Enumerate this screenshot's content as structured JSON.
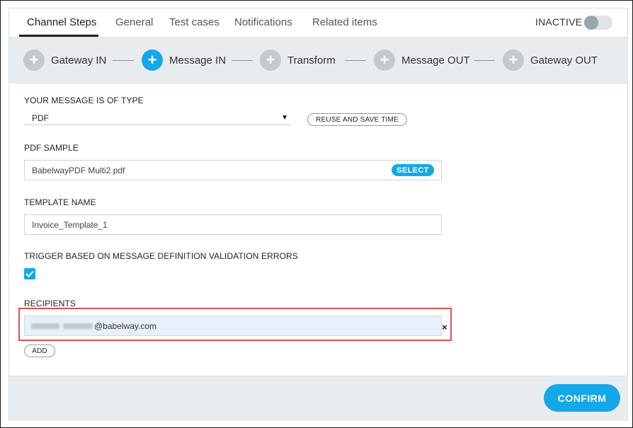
{
  "tabs": [
    {
      "label": "Channel Steps",
      "active": true
    },
    {
      "label": "General"
    },
    {
      "label": "Test cases"
    },
    {
      "label": "Notifications"
    },
    {
      "label": "Related items"
    }
  ],
  "status": {
    "label": "INACTIVE",
    "enabled": false
  },
  "steps": [
    {
      "label": "Gateway IN",
      "icon": "plus-icon"
    },
    {
      "label": "Message IN",
      "icon": "plus-icon",
      "active": true
    },
    {
      "label": "Transform",
      "icon": "plus-icon"
    },
    {
      "label": "Message OUT",
      "icon": "plus-icon"
    },
    {
      "label": "Gateway OUT",
      "icon": "plus-icon"
    }
  ],
  "form": {
    "message_type": {
      "label": "YOUR MESSAGE IS OF TYPE",
      "value": "PDF",
      "reuse_button": "REUSE AND SAVE TIME"
    },
    "pdf_sample": {
      "label": "PDF SAMPLE",
      "value": "BabelwayPDF Multi2.pdf",
      "select_button": "SELECT"
    },
    "template_name": {
      "label": "TEMPLATE NAME",
      "value": "Invoice_Template_1"
    },
    "trigger": {
      "label": "TRIGGER BASED ON MESSAGE DEFINITION VALIDATION ERRORS",
      "checked": true
    },
    "recipients": {
      "label": "RECIPIENTS",
      "items": [
        {
          "value": "@babelway.com"
        }
      ],
      "remove_glyph": "×",
      "add_button": "ADD"
    }
  },
  "footer": {
    "confirm_button": "CONFIRM"
  },
  "colors": {
    "accent": "#14a8e8",
    "highlight": "#d9534f",
    "step_inactive": "#c4c9cd"
  }
}
